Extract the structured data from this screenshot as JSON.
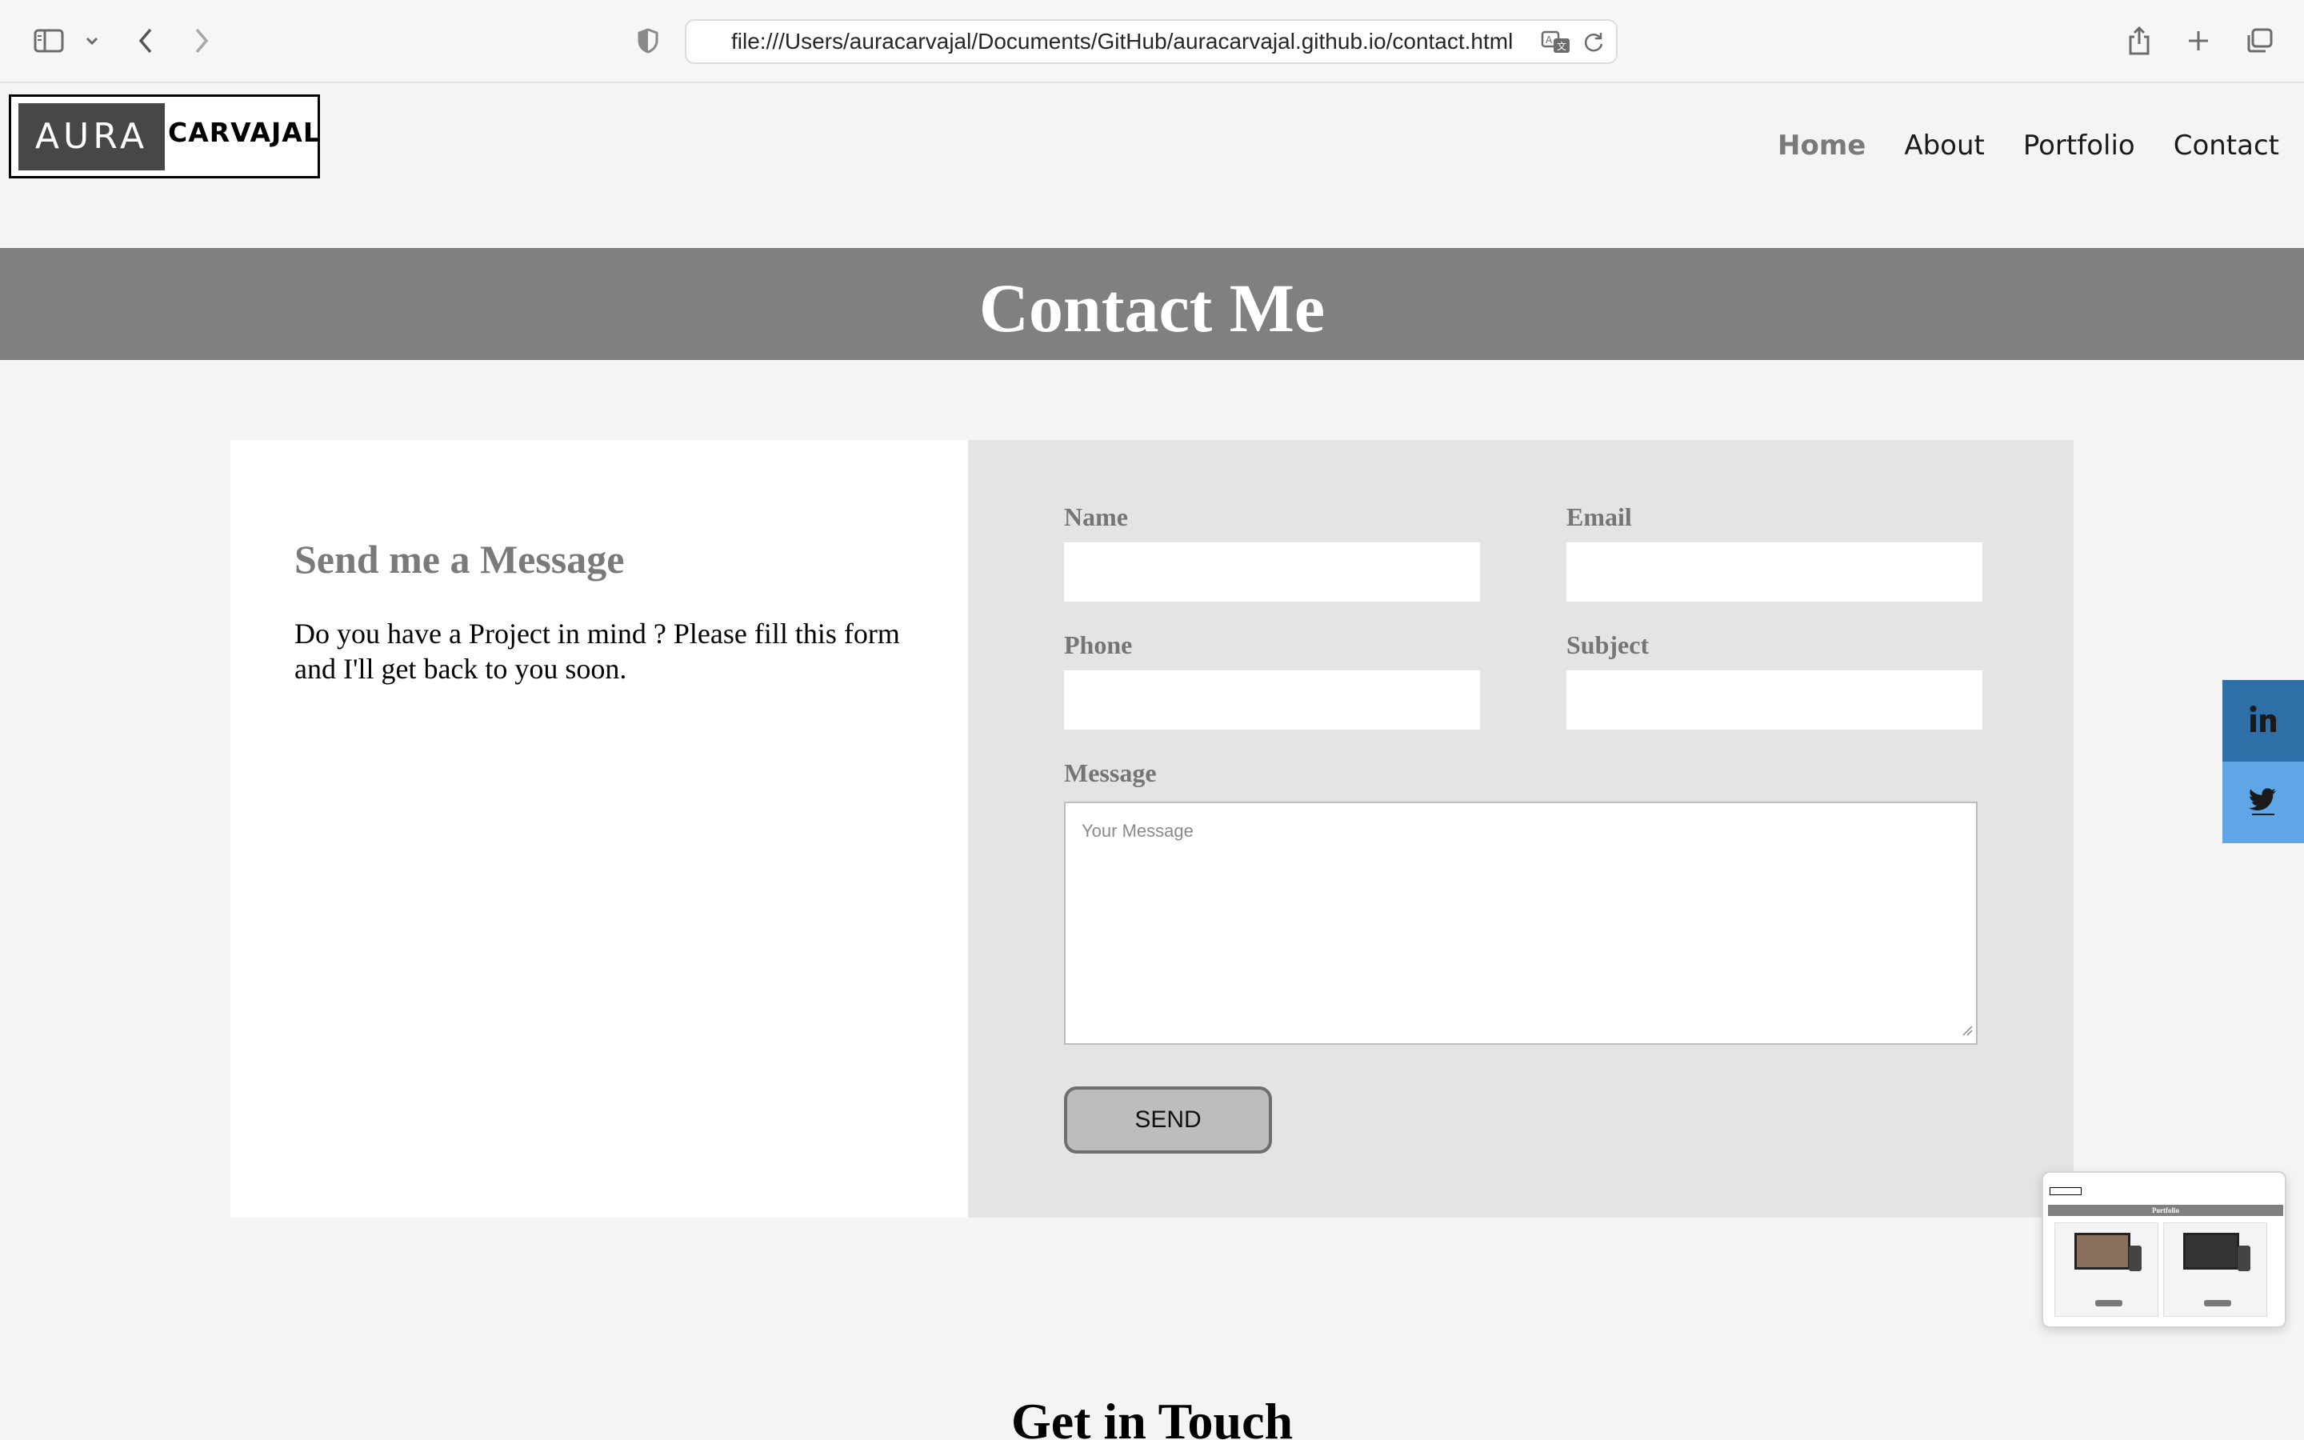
{
  "browser": {
    "url": "file:///Users/auracarvajal/Documents/GitHub/auracarvajal.github.io/contact.html"
  },
  "site": {
    "logo_dark": "AURA",
    "logo_light": "CARVAJAL",
    "nav": [
      {
        "label": "Home",
        "active": true
      },
      {
        "label": "About",
        "active": false
      },
      {
        "label": "Portfolio",
        "active": false
      },
      {
        "label": "Contact",
        "active": false
      }
    ]
  },
  "banner": {
    "title": "Contact Me"
  },
  "intro": {
    "heading": "Send me a Message",
    "text": "Do you have a Project in mind ? Please fill this form and I'll get back to you soon."
  },
  "form": {
    "name_label": "Name",
    "email_label": "Email",
    "phone_label": "Phone",
    "subject_label": "Subject",
    "message_label": "Message",
    "message_placeholder": "Your Message",
    "send_label": "SEND"
  },
  "thumbnail": {
    "title": "Portfolio"
  },
  "footer": {
    "heading": "Get in Touch"
  },
  "colors": {
    "banner": "#808080",
    "linkedin": "#2f6fa8",
    "twitter": "#5ea6e6",
    "form_bg": "#e4e4e4"
  }
}
